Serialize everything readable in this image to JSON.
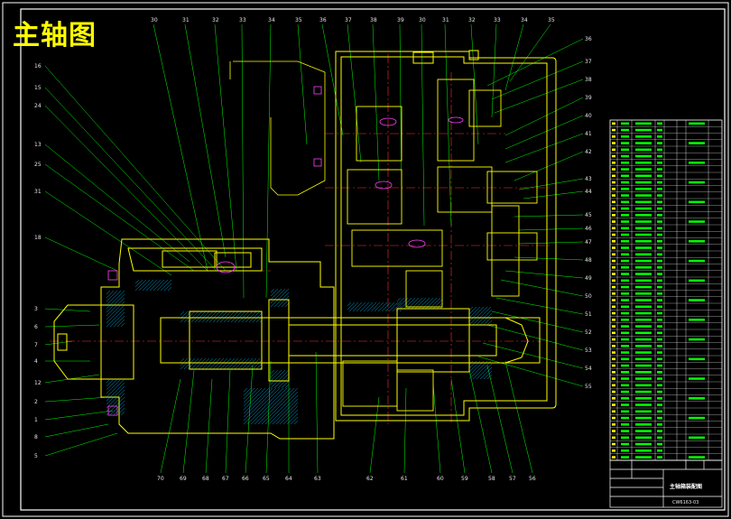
{
  "title": "主轴图",
  "colors": {
    "background": "#000000",
    "frame": "#ffffff",
    "outline": "#ffff00",
    "leader": "#00ff00",
    "centerline": "#ff3030",
    "hatch": "#00c8ff",
    "bolt": "#ff40ff",
    "title_text": "#ffff00"
  },
  "balloons": {
    "top": [
      "30",
      "31",
      "32",
      "33",
      "34",
      "35",
      "36",
      "37",
      "38",
      "39",
      "30",
      "31",
      "32",
      "33",
      "34",
      "35"
    ],
    "left": [
      "16",
      "15",
      "24",
      "13",
      "25",
      "31",
      "18",
      "3",
      "6",
      "7",
      "4",
      "12",
      "2",
      "1",
      "8",
      "5"
    ],
    "right": [
      "36",
      "37",
      "38",
      "39",
      "40",
      "41",
      "42",
      "43",
      "44",
      "45",
      "46",
      "47",
      "48",
      "49",
      "50",
      "51",
      "52",
      "53",
      "54",
      "55"
    ],
    "bottom": [
      "70",
      "69",
      "68",
      "67",
      "66",
      "65",
      "64",
      "63",
      "62",
      "61",
      "60",
      "59",
      "58",
      "57",
      "56"
    ]
  },
  "title_block": {
    "name": "主轴箱装配图",
    "code": "CW6163-03"
  }
}
